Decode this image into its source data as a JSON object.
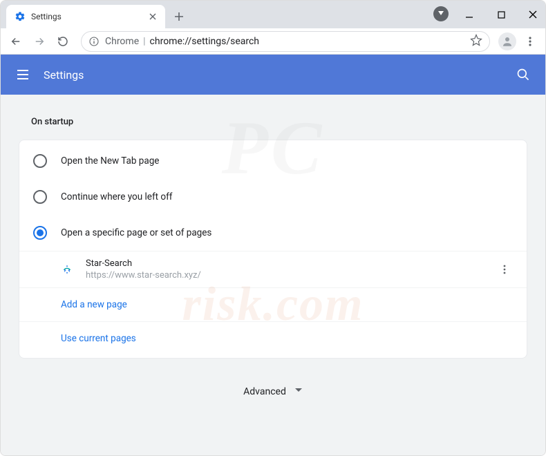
{
  "window": {
    "tab_title": "Settings"
  },
  "toolbar": {
    "chrome_label": "Chrome",
    "url_path": "chrome://settings/search"
  },
  "header": {
    "title": "Settings"
  },
  "section": {
    "title": "On startup"
  },
  "options": {
    "opt1": "Open the New Tab page",
    "opt2": "Continue where you left off",
    "opt3": "Open a specific page or set of pages"
  },
  "startup_page": {
    "name": "Star-Search",
    "url": "https://www.star-search.xyz/"
  },
  "actions": {
    "add_new_page": "Add a new page",
    "use_current": "Use current pages"
  },
  "footer": {
    "advanced": "Advanced"
  },
  "colors": {
    "accent": "#1a73e8",
    "header": "#5078d7"
  }
}
